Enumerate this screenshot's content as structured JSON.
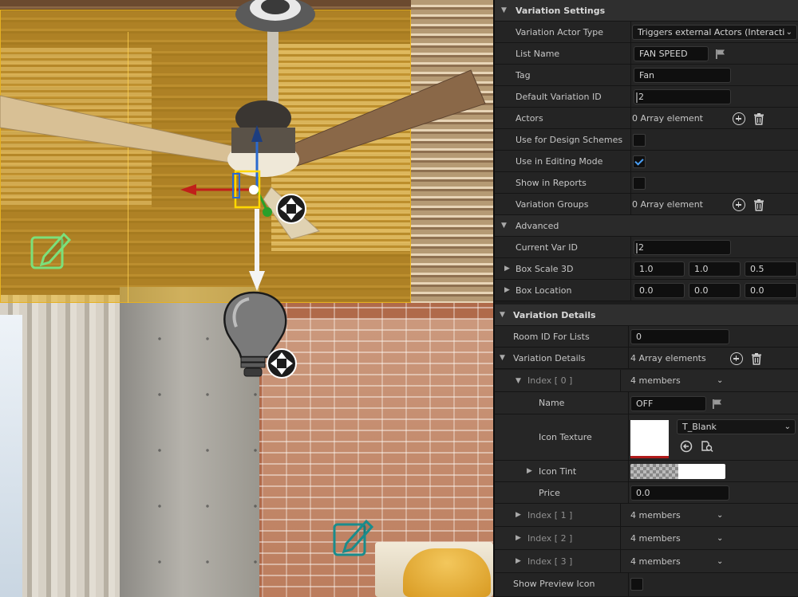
{
  "panel": {
    "variation_settings": {
      "title": "Variation Settings",
      "actor_type": {
        "label": "Variation Actor Type",
        "value": "Triggers external Actors (Interacti"
      },
      "list_name": {
        "label": "List Name",
        "value": "FAN SPEED"
      },
      "tag": {
        "label": "Tag",
        "value": "Fan"
      },
      "default_variation_id": {
        "label": "Default Variation ID",
        "value": "2"
      },
      "actors": {
        "label": "Actors",
        "value": "0 Array element"
      },
      "use_for_design_schemes": {
        "label": "Use for Design Schemes",
        "checked": false
      },
      "use_in_editing_mode": {
        "label": "Use in Editing Mode",
        "checked": true
      },
      "show_in_reports": {
        "label": "Show in Reports",
        "checked": false
      },
      "variation_groups": {
        "label": "Variation Groups",
        "value": "0 Array element"
      },
      "advanced": {
        "title": "Advanced",
        "current_var_id": {
          "label": "Current Var ID",
          "value": "2"
        },
        "box_scale_3d": {
          "label": "Box Scale 3D",
          "x": "1.0",
          "y": "1.0",
          "z": "0.5"
        },
        "box_location": {
          "label": "Box Location",
          "x": "0.0",
          "y": "0.0",
          "z": "0.0"
        }
      }
    },
    "variation_details": {
      "title": "Variation Details",
      "room_id_for_lists": {
        "label": "Room ID For Lists",
        "value": "0"
      },
      "details_array": {
        "label": "Variation Details",
        "value": "4 Array elements"
      },
      "index0": {
        "label": "Index [ 0 ]",
        "value": "4 members",
        "name": {
          "label": "Name",
          "value": "OFF"
        },
        "icon_texture": {
          "label": "Icon Texture",
          "asset": "T_Blank"
        },
        "icon_tint": {
          "label": "Icon Tint"
        },
        "price": {
          "label": "Price",
          "value": "0.0"
        }
      },
      "index1": {
        "label": "Index [ 1 ]",
        "value": "4 members"
      },
      "index2": {
        "label": "Index [ 2 ]",
        "value": "4 members"
      },
      "index3": {
        "label": "Index [ 3 ]",
        "value": "4 members"
      },
      "show_preview_icon": {
        "label": "Show Preview Icon",
        "checked": false
      }
    }
  },
  "colors": {
    "selection": "#e6b020",
    "checkbox_check": "#4a9ff5",
    "gizmo_x": "#c0201a",
    "gizmo_y": "#2aa02a",
    "gizmo_z": "#2a6ad0",
    "edit_icon_green": "#7be07b",
    "edit_icon_teal": "#1a8c8c"
  },
  "icons": [
    "fan-actor-icon",
    "lightbulb-actor-icon",
    "move-gizmo-icon",
    "edit-note-icon",
    "flag-icon",
    "add-element-icon",
    "trash-icon",
    "reset-arrow-icon",
    "browse-asset-icon",
    "chevron-down-icon",
    "expand-arrow-icon"
  ]
}
